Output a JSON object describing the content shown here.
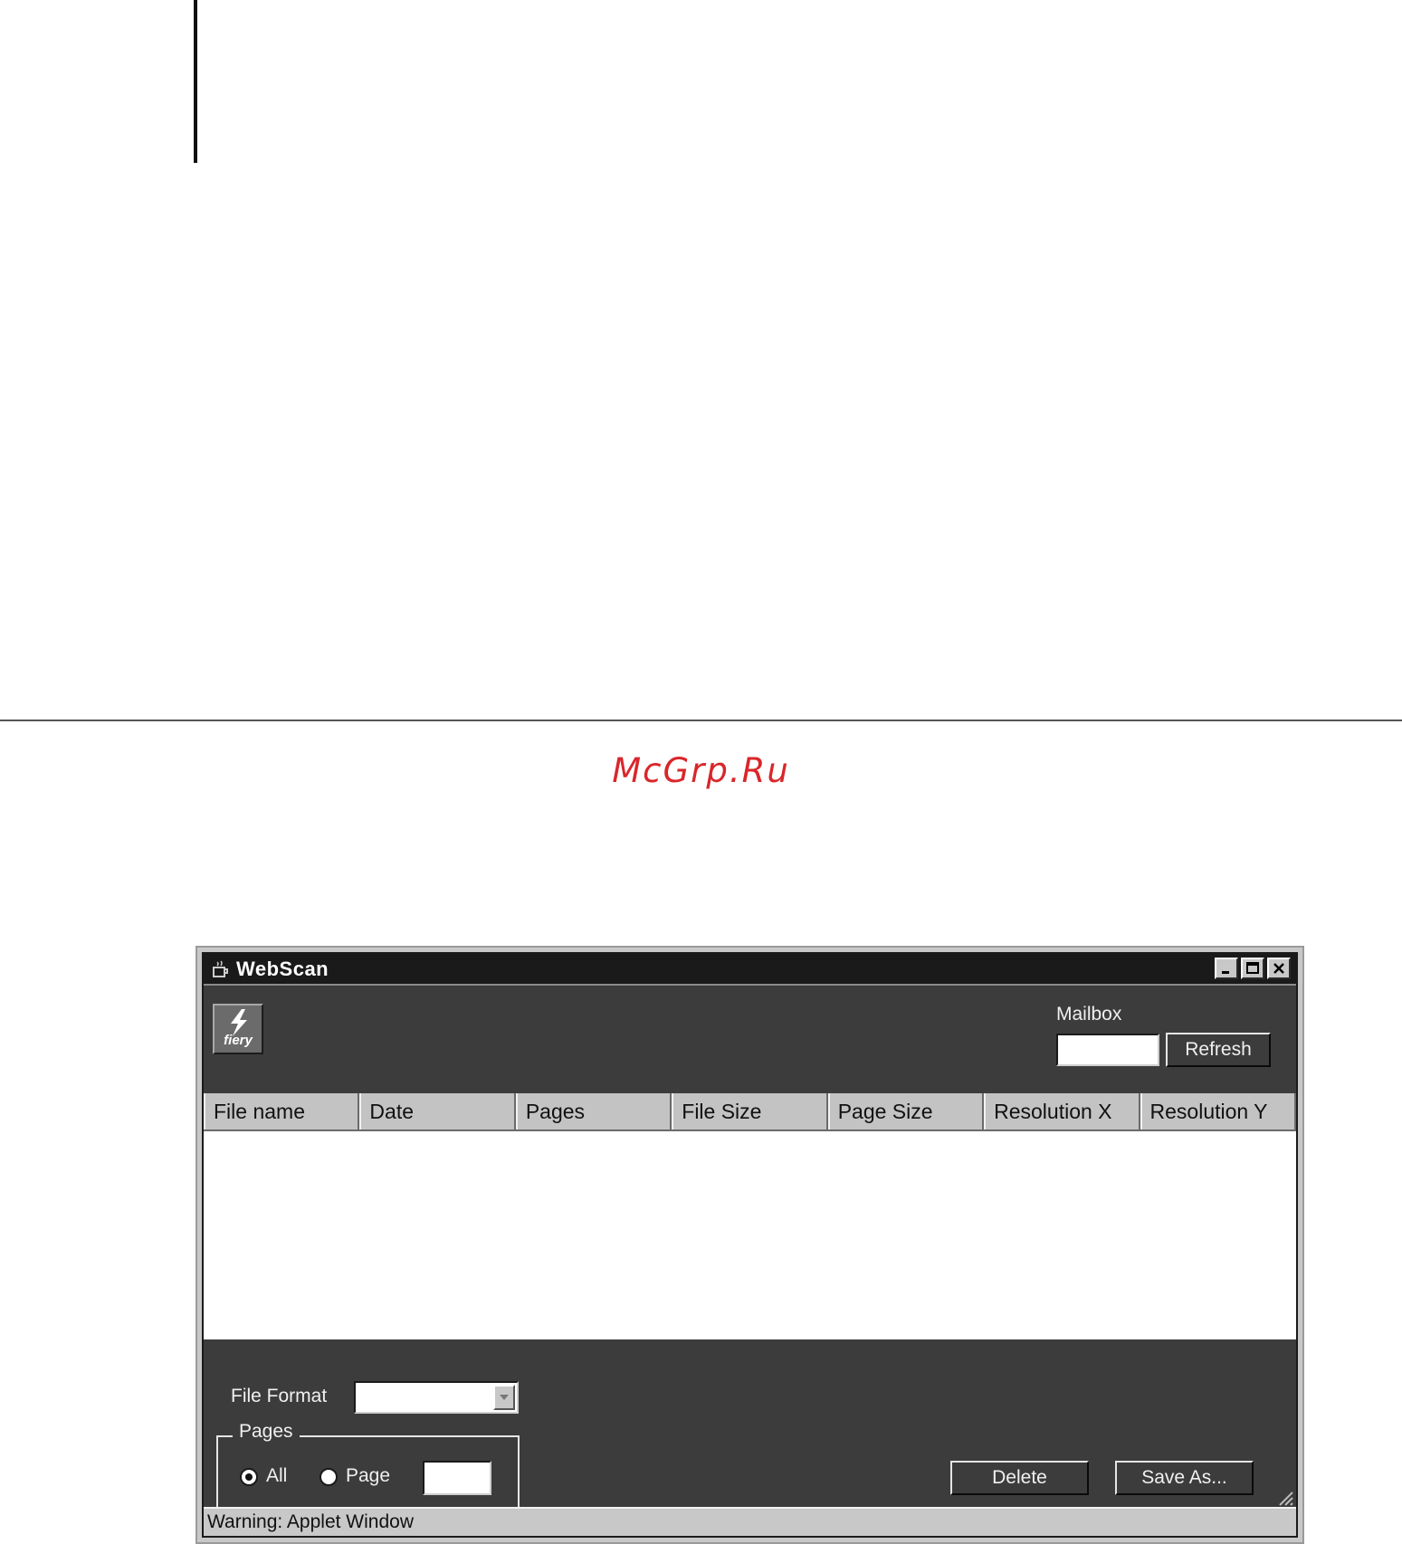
{
  "watermark": "McGrp.Ru",
  "window": {
    "title": "WebScan",
    "logo_text": "fiery",
    "mailbox_label": "Mailbox",
    "mailbox_value": "",
    "refresh_label": "Refresh",
    "columns": [
      "File name",
      "Date",
      "Pages",
      "File Size",
      "Page Size",
      "Resolution X",
      "Resolution Y"
    ],
    "file_format_label": "File Format",
    "file_format_value": "",
    "pages_group_label": "Pages",
    "radio_all_label": "All",
    "radio_page_label": "Page",
    "radio_selected": "All",
    "page_value": "",
    "delete_label": "Delete",
    "save_as_label": "Save As...",
    "status_text": "Warning: Applet Window"
  }
}
